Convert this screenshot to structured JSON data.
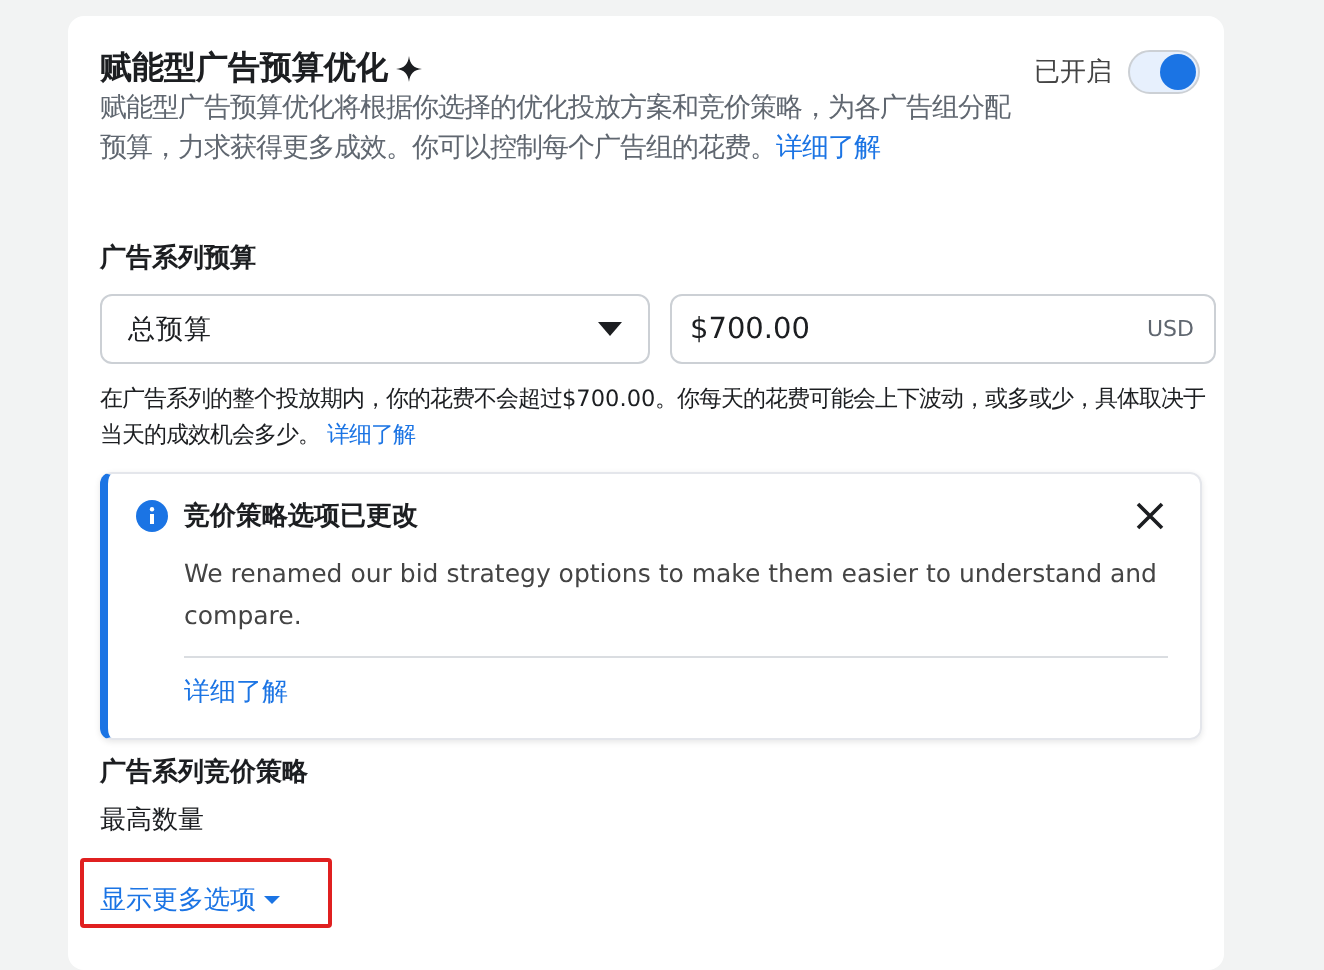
{
  "section": {
    "title": "赋能型广告预算优化",
    "toggle": {
      "label": "已开启",
      "on": true
    },
    "description": "赋能型广告预算优化将根据你选择的优化投放方案和竞价策略，为各广告组分配预算，力求获得更多成效。你可以控制每个广告组的花费。",
    "description_link": "详细了解"
  },
  "budget": {
    "label": "广告系列预算",
    "type_select": {
      "value": "总预算"
    },
    "amount": {
      "value": "$700.00",
      "currency": "USD"
    },
    "help": "在广告系列的整个投放期内，你的花费不会超过$700.00。你每天的花费可能会上下波动，或多或少，具体取决于当天的成效机会多少。",
    "help_link": "详细了解"
  },
  "notice": {
    "title": "竞价策略选项已更改",
    "body": "We renamed our bid strategy options to make them easier to understand and compare.",
    "link": "详细了解"
  },
  "bid_strategy": {
    "label": "广告系列竞价策略",
    "value": "最高数量"
  },
  "more_options": {
    "label": "显示更多选项",
    "highlighted": true
  }
}
